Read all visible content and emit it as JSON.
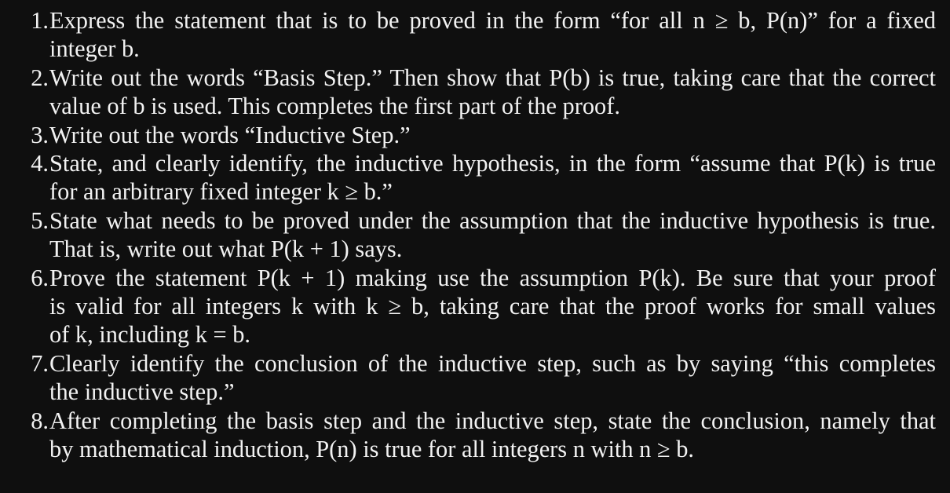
{
  "steps": [
    {
      "number": "1.",
      "lines": [
        "Express the statement that is to be proved in the form “for all n ≥ b, P(n)” for a fixed",
        "integer b."
      ]
    },
    {
      "number": "2.",
      "lines": [
        "Write out the words “Basis Step.” Then show that P(b) is true, taking care that the correct",
        "value of b is used. This completes the first part of the proof."
      ]
    },
    {
      "number": "3.",
      "lines": [
        "Write out the words “Inductive Step.”"
      ]
    },
    {
      "number": "4.",
      "lines": [
        "State, and clearly identify, the inductive hypothesis, in the form “assume that P(k) is true",
        "for an arbitrary fixed integer k ≥ b.”"
      ]
    },
    {
      "number": "5.",
      "lines": [
        "State what needs to be proved under the assumption that the inductive hypothesis is true.",
        "That is, write out what P(k + 1) says."
      ]
    },
    {
      "number": "6.",
      "lines": [
        "Prove the statement P(k + 1) making use the assumption P(k). Be sure that your proof",
        "is valid for all integers k with k ≥ b, taking care that the proof works for small values",
        "of k, including k = b."
      ]
    },
    {
      "number": "7.",
      "lines": [
        "Clearly identify the conclusion of the inductive step, such as by saying “this completes",
        "the inductive step.”"
      ]
    },
    {
      "number": "8.",
      "lines": [
        "After completing the basis step and the inductive step, state the conclusion, namely that",
        "by mathematical induction, P(n) is true for all integers n with n ≥ b."
      ]
    }
  ]
}
